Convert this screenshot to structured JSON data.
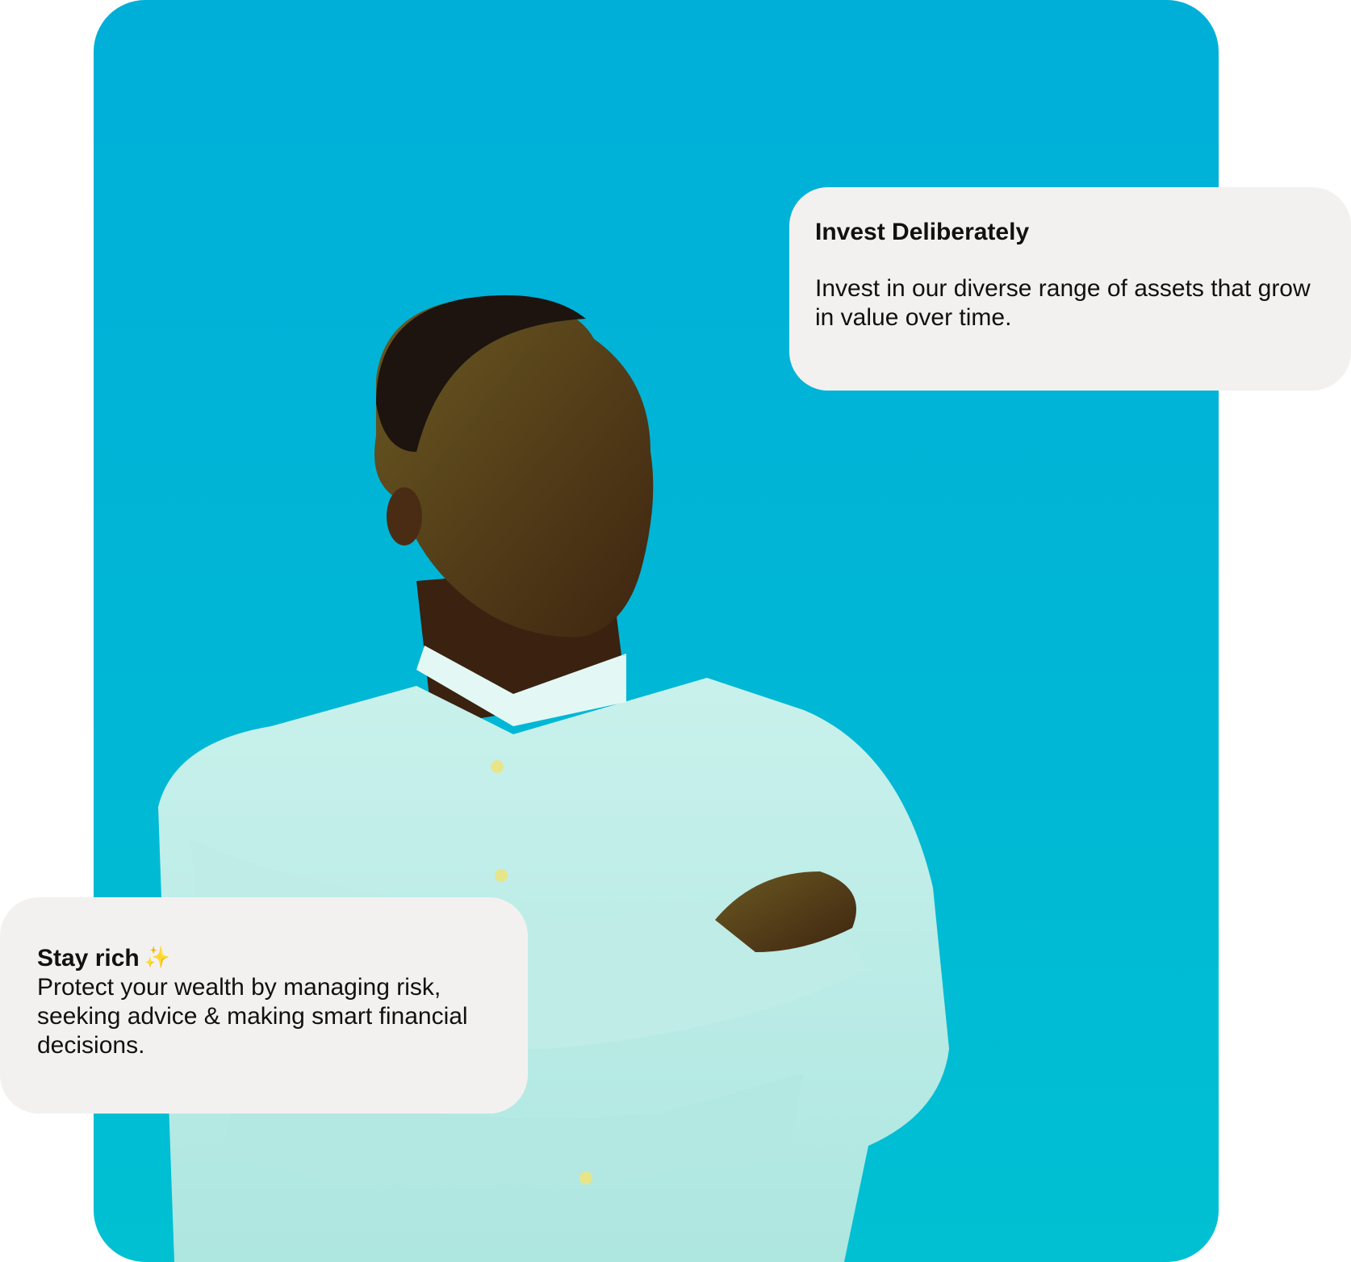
{
  "cards": {
    "invest": {
      "title": "Invest Deliberately",
      "body": "Invest in our diverse range of assets that grow in value over time."
    },
    "rich": {
      "title": "Stay rich",
      "icon": "sparkles-icon",
      "body": "Protect your wealth by managing risk, seeking advice & making smart financial decisions."
    }
  },
  "colors": {
    "sky": "#00b3d6",
    "card": "#f3f1f0",
    "text": "#111111",
    "sparkle": "#f6c343"
  }
}
